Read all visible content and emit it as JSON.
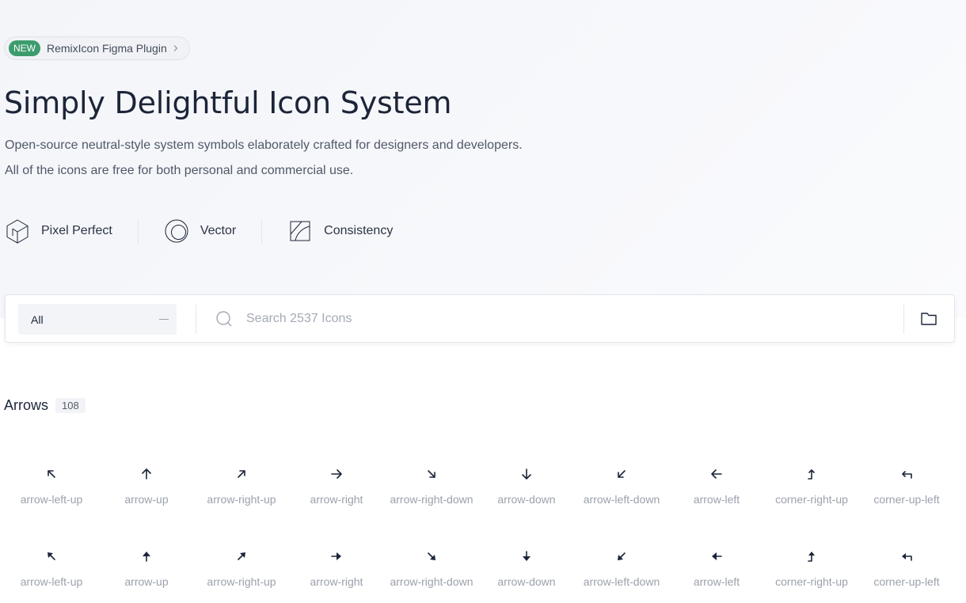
{
  "badge": {
    "tag": "NEW",
    "label": "RemixIcon Figma Plugin"
  },
  "hero": {
    "title": "Simply Delightful Icon System",
    "desc_line1": "Open-source neutral-style system symbols elaborately crafted for designers and developers.",
    "desc_line2": "All of the icons are free for both personal and commercial use."
  },
  "features": [
    {
      "label": "Pixel Perfect",
      "icon": "cube-icon"
    },
    {
      "label": "Vector",
      "icon": "vector-circle-icon"
    },
    {
      "label": "Consistency",
      "icon": "consistency-square-icon"
    }
  ],
  "search": {
    "category_value": "All",
    "placeholder": "Search 2537 Icons"
  },
  "section": {
    "name": "Arrows",
    "count": "108"
  },
  "icons_row1": [
    "arrow-left-up",
    "arrow-up",
    "arrow-right-up",
    "arrow-right",
    "arrow-right-down",
    "arrow-down",
    "arrow-left-down",
    "arrow-left",
    "corner-right-up",
    "corner-up-left"
  ],
  "icons_row2": [
    "arrow-left-up",
    "arrow-up",
    "arrow-right-up",
    "arrow-right",
    "arrow-right-down",
    "arrow-down",
    "arrow-left-down",
    "arrow-left",
    "corner-right-up",
    "corner-up-left"
  ],
  "colors": {
    "accent_green": "#3d9c6d",
    "text_dark": "#1c2538",
    "muted": "#9ba1ac"
  }
}
